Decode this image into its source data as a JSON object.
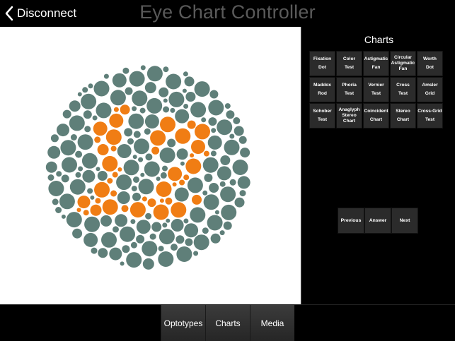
{
  "header": {
    "back_label": "Disconnect",
    "title": "Eye Chart Controller"
  },
  "panel": {
    "title": "Charts",
    "charts": [
      {
        "l1": "Fixation",
        "l2": "",
        "l3": "Dot"
      },
      {
        "l1": "Color",
        "l2": "",
        "l3": "Test"
      },
      {
        "l1": "Astigmatic",
        "l2": "",
        "l3": "Fan"
      },
      {
        "l1": "Circular",
        "l2": "Astigmatic",
        "l3": "Fan"
      },
      {
        "l1": "Worth",
        "l2": "",
        "l3": "Dot"
      },
      {
        "l1": "Maddox",
        "l2": "",
        "l3": "Rod"
      },
      {
        "l1": "Phoria",
        "l2": "",
        "l3": "Test"
      },
      {
        "l1": "Vernier",
        "l2": "",
        "l3": "Test"
      },
      {
        "l1": "Cross",
        "l2": "",
        "l3": "Test"
      },
      {
        "l1": "Amsler",
        "l2": "",
        "l3": "Grid"
      },
      {
        "l1": "Schober",
        "l2": "",
        "l3": "Test"
      },
      {
        "l1": "Anaglyph",
        "l2": "Stereo",
        "l3": "Chart"
      },
      {
        "l1": "Coincident",
        "l2": "",
        "l3": "Chart"
      },
      {
        "l1": "Stereo",
        "l2": "",
        "l3": "Chart"
      },
      {
        "l1": "Cross-Grid",
        "l2": "",
        "l3": "Test"
      }
    ],
    "nav": {
      "previous": "Previous",
      "answer": "Answer",
      "next": "Next"
    }
  },
  "tabs": {
    "optotypes": "Optotypes",
    "charts": "Charts",
    "media": "Media"
  },
  "plate": {
    "background_color": "#5f7f79",
    "figure_color": "#f07d14"
  }
}
